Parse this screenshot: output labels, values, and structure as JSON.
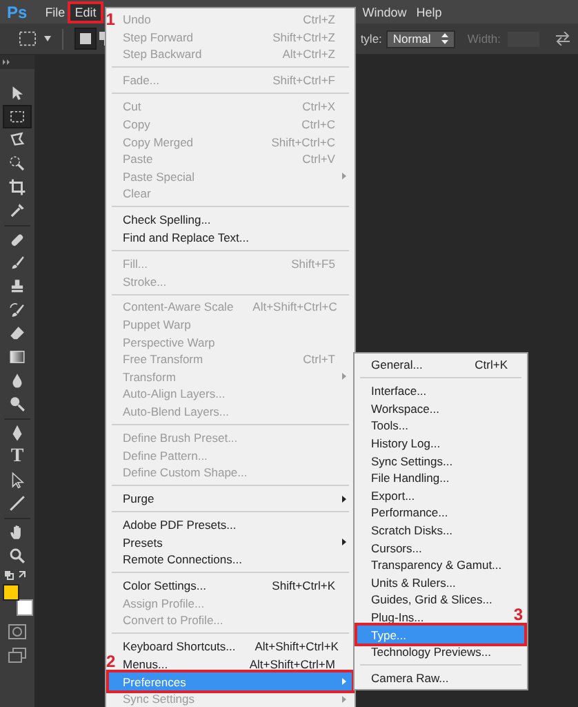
{
  "app_logo": "Ps",
  "menubar": [
    {
      "label": "File",
      "selected": false
    },
    {
      "label": "Edit",
      "selected": true,
      "callout": "1"
    },
    {
      "label": "Window",
      "selected": false
    },
    {
      "label": "Help",
      "selected": false
    }
  ],
  "options": {
    "style_label": "tyle:",
    "style_value": "Normal",
    "width_label": "Width:",
    "width_disabled": true
  },
  "tools": [
    {
      "kind": "move",
      "selected": false
    },
    {
      "kind": "marquee",
      "selected": true
    },
    {
      "kind": "lasso",
      "selected": false
    },
    {
      "kind": "quick-select",
      "selected": false
    },
    {
      "kind": "crop",
      "selected": false
    },
    {
      "kind": "eyedropper",
      "selected": false
    },
    {
      "kind": "separator"
    },
    {
      "kind": "healing",
      "selected": false
    },
    {
      "kind": "brush",
      "selected": false
    },
    {
      "kind": "stamp",
      "selected": false
    },
    {
      "kind": "history-brush",
      "selected": false
    },
    {
      "kind": "eraser",
      "selected": false
    },
    {
      "kind": "gradient",
      "selected": false
    },
    {
      "kind": "blur",
      "selected": false
    },
    {
      "kind": "dodge",
      "selected": false
    },
    {
      "kind": "separator"
    },
    {
      "kind": "pen",
      "selected": false
    },
    {
      "kind": "type",
      "glyph": "T",
      "selected": false
    },
    {
      "kind": "path-select",
      "selected": false
    },
    {
      "kind": "line",
      "selected": false
    },
    {
      "kind": "separator"
    },
    {
      "kind": "hand",
      "selected": false
    },
    {
      "kind": "zoom",
      "selected": false
    }
  ],
  "swatches": [
    {
      "kind": "background",
      "color": "#ffffff"
    },
    {
      "kind": "foreground",
      "color": "#ffcc00"
    }
  ],
  "edit_menu": {
    "groups": [
      {
        "items": [
          {
            "label": "Undo",
            "shortcut": "Ctrl+Z",
            "disabled": true,
            "submenu": false,
            "selected": false
          },
          {
            "label": "Step Forward",
            "shortcut": "Shift+Ctrl+Z",
            "disabled": true,
            "submenu": false,
            "selected": false
          },
          {
            "label": "Step Backward",
            "shortcut": "Alt+Ctrl+Z",
            "disabled": true,
            "submenu": false,
            "selected": false
          }
        ]
      },
      {
        "items": [
          {
            "label": "Fade...",
            "shortcut": "Shift+Ctrl+F",
            "disabled": true,
            "submenu": false,
            "selected": false
          }
        ]
      },
      {
        "items": [
          {
            "label": "Cut",
            "shortcut": "Ctrl+X",
            "disabled": true,
            "submenu": false,
            "selected": false
          },
          {
            "label": "Copy",
            "shortcut": "Ctrl+C",
            "disabled": true,
            "submenu": false,
            "selected": false
          },
          {
            "label": "Copy Merged",
            "shortcut": "Shift+Ctrl+C",
            "disabled": true,
            "submenu": false,
            "selected": false
          },
          {
            "label": "Paste",
            "shortcut": "Ctrl+V",
            "disabled": true,
            "submenu": false,
            "selected": false
          },
          {
            "label": "Paste Special",
            "disabled": true,
            "submenu": true,
            "selected": false
          },
          {
            "label": "Clear",
            "disabled": true,
            "submenu": false,
            "selected": false
          }
        ]
      },
      {
        "items": [
          {
            "label": "Check Spelling...",
            "disabled": false,
            "submenu": false,
            "selected": false
          },
          {
            "label": "Find and Replace Text...",
            "disabled": false,
            "submenu": false,
            "selected": false
          }
        ]
      },
      {
        "items": [
          {
            "label": "Fill...",
            "shortcut": "Shift+F5",
            "disabled": true,
            "submenu": false,
            "selected": false
          },
          {
            "label": "Stroke...",
            "disabled": true,
            "submenu": false,
            "selected": false
          }
        ]
      },
      {
        "items": [
          {
            "label": "Content-Aware Scale",
            "shortcut": "Alt+Shift+Ctrl+C",
            "disabled": true,
            "submenu": false,
            "selected": false
          },
          {
            "label": "Puppet Warp",
            "disabled": true,
            "submenu": false,
            "selected": false
          },
          {
            "label": "Perspective Warp",
            "disabled": true,
            "submenu": false,
            "selected": false
          },
          {
            "label": "Free Transform",
            "shortcut": "Ctrl+T",
            "disabled": true,
            "submenu": false,
            "selected": false
          },
          {
            "label": "Transform",
            "disabled": true,
            "submenu": true,
            "selected": false
          },
          {
            "label": "Auto-Align Layers...",
            "disabled": true,
            "submenu": false,
            "selected": false
          },
          {
            "label": "Auto-Blend Layers...",
            "disabled": true,
            "submenu": false,
            "selected": false
          }
        ]
      },
      {
        "items": [
          {
            "label": "Define Brush Preset...",
            "disabled": true,
            "submenu": false,
            "selected": false
          },
          {
            "label": "Define Pattern...",
            "disabled": true,
            "submenu": false,
            "selected": false
          },
          {
            "label": "Define Custom Shape...",
            "disabled": true,
            "submenu": false,
            "selected": false
          }
        ]
      },
      {
        "items": [
          {
            "label": "Purge",
            "disabled": false,
            "submenu": true,
            "selected": false
          }
        ]
      },
      {
        "items": [
          {
            "label": "Adobe PDF Presets...",
            "disabled": false,
            "submenu": false,
            "selected": false
          },
          {
            "label": "Presets",
            "disabled": false,
            "submenu": true,
            "selected": false
          },
          {
            "label": "Remote Connections...",
            "disabled": false,
            "submenu": false,
            "selected": false
          }
        ]
      },
      {
        "items": [
          {
            "label": "Color Settings...",
            "shortcut": "Shift+Ctrl+K",
            "disabled": false,
            "submenu": false,
            "selected": false
          },
          {
            "label": "Assign Profile...",
            "disabled": true,
            "submenu": false,
            "selected": false
          },
          {
            "label": "Convert to Profile...",
            "disabled": true,
            "submenu": false,
            "selected": false
          }
        ]
      },
      {
        "items": [
          {
            "label": "Keyboard Shortcuts...",
            "shortcut": "Alt+Shift+Ctrl+K",
            "disabled": false,
            "submenu": false,
            "selected": false
          },
          {
            "label": "Menus...",
            "shortcut": "Alt+Shift+Ctrl+M",
            "disabled": false,
            "submenu": false,
            "selected": false
          },
          {
            "label": "Preferences",
            "disabled": false,
            "submenu": true,
            "selected": true,
            "callout": "2"
          },
          {
            "label": "Sync Settings",
            "disabled": true,
            "submenu": true,
            "selected": false
          }
        ]
      }
    ]
  },
  "preferences_menu": {
    "groups": [
      {
        "items": [
          {
            "label": "General...",
            "shortcut": "Ctrl+K",
            "disabled": false,
            "submenu": false,
            "selected": false
          }
        ]
      },
      {
        "items": [
          {
            "label": "Interface...",
            "disabled": false,
            "submenu": false,
            "selected": false
          },
          {
            "label": "Workspace...",
            "disabled": false,
            "submenu": false,
            "selected": false
          },
          {
            "label": "Tools...",
            "disabled": false,
            "submenu": false,
            "selected": false
          },
          {
            "label": "History Log...",
            "disabled": false,
            "submenu": false,
            "selected": false
          },
          {
            "label": "Sync Settings...",
            "disabled": false,
            "submenu": false,
            "selected": false
          },
          {
            "label": "File Handling...",
            "disabled": false,
            "submenu": false,
            "selected": false
          },
          {
            "label": "Export...",
            "disabled": false,
            "submenu": false,
            "selected": false
          },
          {
            "label": "Performance...",
            "disabled": false,
            "submenu": false,
            "selected": false
          },
          {
            "label": "Scratch Disks...",
            "disabled": false,
            "submenu": false,
            "selected": false
          },
          {
            "label": "Cursors...",
            "disabled": false,
            "submenu": false,
            "selected": false
          },
          {
            "label": "Transparency & Gamut...",
            "disabled": false,
            "submenu": false,
            "selected": false
          },
          {
            "label": "Units & Rulers...",
            "disabled": false,
            "submenu": false,
            "selected": false
          },
          {
            "label": "Guides, Grid & Slices...",
            "disabled": false,
            "submenu": false,
            "selected": false
          },
          {
            "label": "Plug-Ins...",
            "disabled": false,
            "submenu": false,
            "selected": false
          },
          {
            "label": "Type...",
            "disabled": false,
            "submenu": false,
            "selected": true,
            "callout": "3"
          },
          {
            "label": "Technology Previews...",
            "disabled": false,
            "submenu": false,
            "selected": false
          }
        ]
      },
      {
        "items": [
          {
            "label": "Camera Raw...",
            "disabled": false,
            "submenu": false,
            "selected": false
          }
        ]
      }
    ]
  }
}
